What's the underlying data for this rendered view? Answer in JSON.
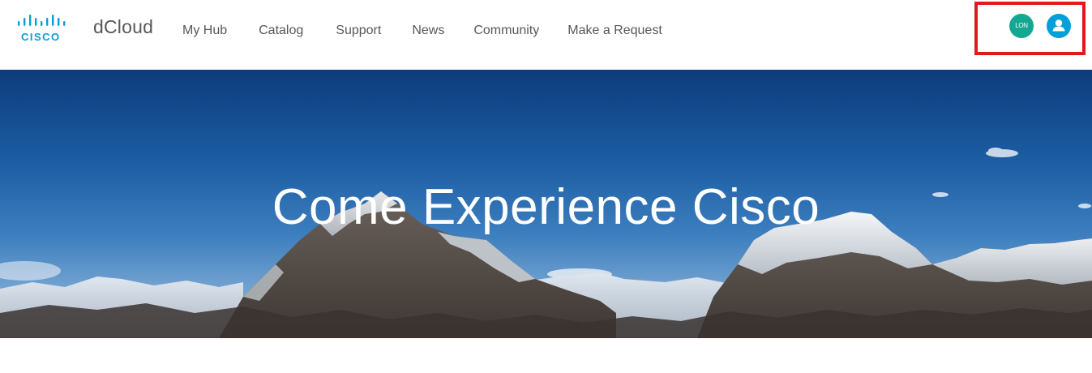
{
  "brand": {
    "logo_text": "CISCO",
    "product_name": "dCloud",
    "color": "#049fd9"
  },
  "nav": {
    "items": [
      {
        "label": "My Hub"
      },
      {
        "label": "Catalog"
      },
      {
        "label": "Support"
      },
      {
        "label": "News"
      },
      {
        "label": "Community"
      },
      {
        "label": "Make a Request"
      }
    ]
  },
  "account": {
    "region_badge": "LON",
    "region_color": "#14a792",
    "avatar_icon": "user-icon",
    "avatar_color": "#049fd9",
    "highlight_color": "#e0191e"
  },
  "hero": {
    "title": "Come Experience Cisco",
    "background": "mountain-range-photo"
  }
}
